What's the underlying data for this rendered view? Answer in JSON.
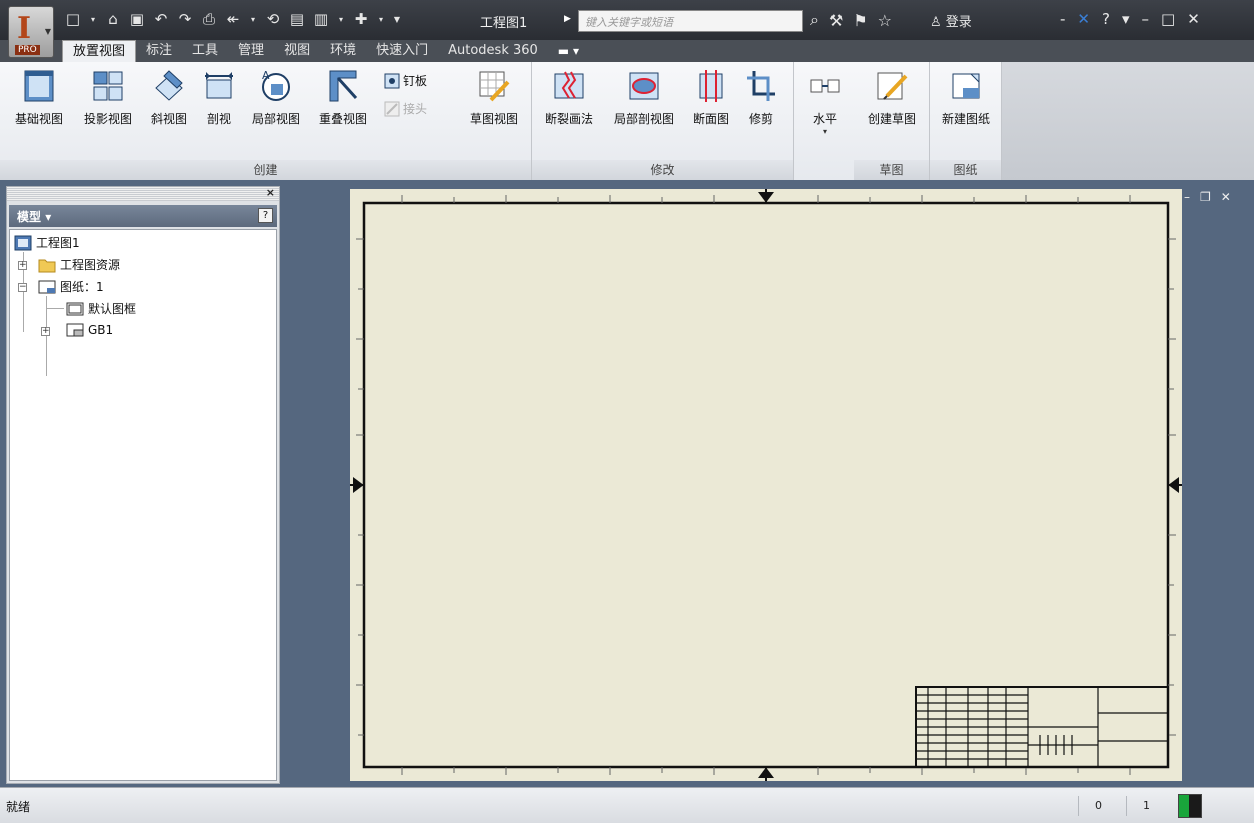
{
  "window": {
    "document_title": "工程图1",
    "search_placeholder": "键入关键字或短语",
    "login_label": "登录",
    "app_badge": "PRO"
  },
  "tabs": [
    {
      "label": "放置视图",
      "active": true
    },
    {
      "label": "标注"
    },
    {
      "label": "工具"
    },
    {
      "label": "管理"
    },
    {
      "label": "视图"
    },
    {
      "label": "环境"
    },
    {
      "label": "快速入门"
    },
    {
      "label": "Autodesk 360"
    }
  ],
  "ribbon": {
    "panels": [
      {
        "title": "创建"
      },
      {
        "title": "修改"
      },
      {
        "title": "草图"
      },
      {
        "title": "图纸"
      }
    ],
    "buttons": {
      "base_view": "基础视图",
      "projected_view": "投影视图",
      "auxiliary_view": "斜视图",
      "section_view": "剖视",
      "detail_view": "局部视图",
      "overlay_view": "重叠视图",
      "nailboard": "钉板",
      "connector": "接头",
      "draft_view": "草图视图",
      "break": "断裂画法",
      "break_out": "局部剖视图",
      "slice": "断面图",
      "crop": "修剪",
      "horizontal": "水平",
      "create_sketch": "创建草图",
      "new_sheet": "新建图纸"
    }
  },
  "browser": {
    "title": "模型",
    "help": "?",
    "tree": [
      {
        "label": "工程图1"
      },
      {
        "label": "工程图资源"
      },
      {
        "label": "图纸：1"
      },
      {
        "label": "默认图框"
      },
      {
        "label": "GB1"
      }
    ]
  },
  "status": {
    "text": "就绪",
    "count_a": "0",
    "count_b": "1"
  },
  "colors": {
    "sheet": "#ebe9d6",
    "workspace": "#55677f",
    "ribbon": "#eceef1"
  }
}
